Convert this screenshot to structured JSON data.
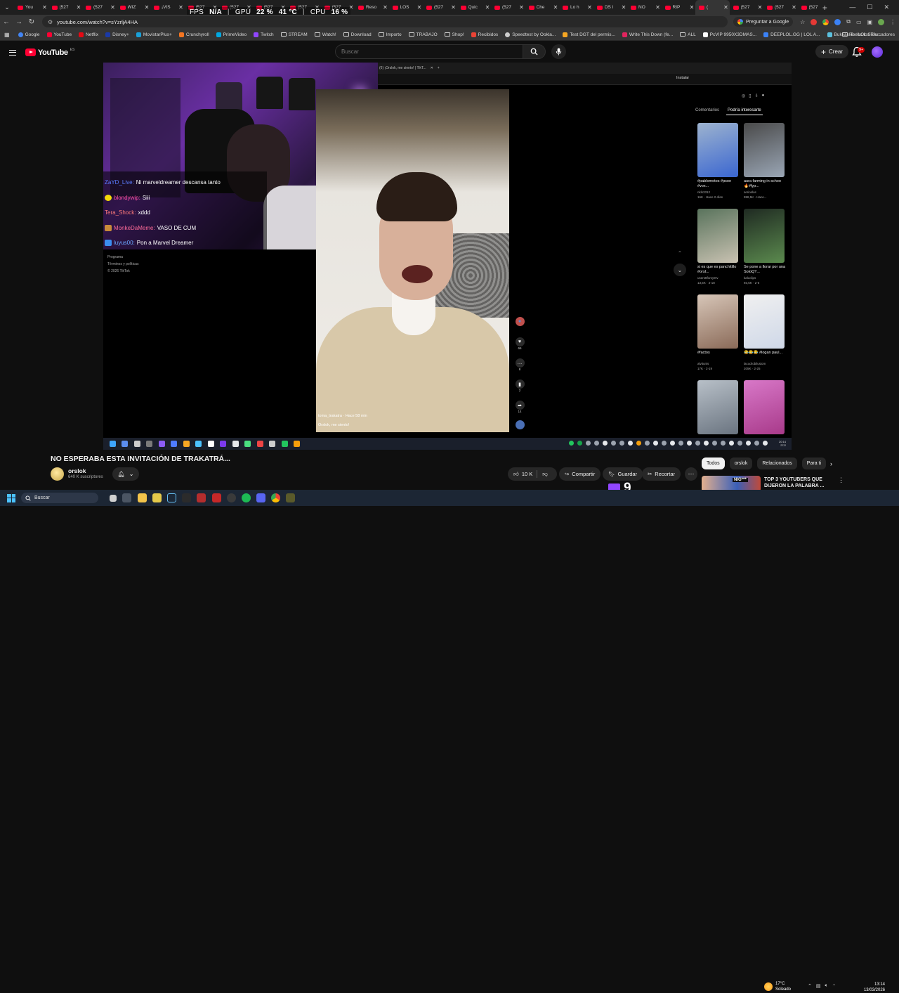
{
  "browser": {
    "tabs": [
      {
        "label": "You",
        "active": false
      },
      {
        "label": "(527",
        "active": false
      },
      {
        "label": "(527",
        "active": false
      },
      {
        "label": "WIZ",
        "active": false
      },
      {
        "label": "¡VIS",
        "active": false
      },
      {
        "label": "(527",
        "active": false
      },
      {
        "label": "(527",
        "active": false
      },
      {
        "label": "(527",
        "active": false
      },
      {
        "label": "(527",
        "active": false
      },
      {
        "label": "(527",
        "active": false
      },
      {
        "label": "Reso",
        "active": false
      },
      {
        "label": "LOS",
        "active": false
      },
      {
        "label": "(527",
        "active": false
      },
      {
        "label": "Quic",
        "active": false
      },
      {
        "label": "(527",
        "active": false
      },
      {
        "label": "Che",
        "active": false
      },
      {
        "label": "Lo h",
        "active": false
      },
      {
        "label": "OS l",
        "active": false
      },
      {
        "label": "NO",
        "active": false
      },
      {
        "label": "RIP",
        "active": false
      },
      {
        "label": "(",
        "active": true
      },
      {
        "label": "(527",
        "active": false
      },
      {
        "label": "(527",
        "active": false
      },
      {
        "label": "(527",
        "active": false
      }
    ],
    "url": "youtube.com/watch?v=sYzrljA4HA",
    "ask_google": "Preguntar a Google",
    "bookmarks": [
      {
        "label": "Google",
        "icon": "google-icon",
        "color": "#4285f4"
      },
      {
        "label": "YouTube",
        "icon": "youtube-icon",
        "color": "#ff0033"
      },
      {
        "label": "Netflix",
        "icon": "netflix-icon",
        "color": "#e50914"
      },
      {
        "label": "Disney+",
        "icon": "disney-icon",
        "color": "#1a3aa8"
      },
      {
        "label": "MovistarPlus+",
        "icon": "movistar-icon",
        "color": "#19a0d8"
      },
      {
        "label": "Crunchyroll",
        "icon": "crunchyroll-icon",
        "color": "#f47521"
      },
      {
        "label": "PrimeVideo",
        "icon": "primevideo-icon",
        "color": "#00a8e1"
      },
      {
        "label": "Twitch",
        "icon": "twitch-icon",
        "color": "#9146ff"
      },
      {
        "label": "STREAM",
        "icon": "folder-icon",
        "color": ""
      },
      {
        "label": "Watch!",
        "icon": "folder-icon",
        "color": ""
      },
      {
        "label": "Download",
        "icon": "folder-icon",
        "color": ""
      },
      {
        "label": "Importo",
        "icon": "folder-icon",
        "color": ""
      },
      {
        "label": "TRABAJO",
        "icon": "folder-icon",
        "color": ""
      },
      {
        "label": "Shop!",
        "icon": "folder-icon",
        "color": ""
      },
      {
        "label": "Recibidos",
        "icon": "gmail-icon",
        "color": "#ea4335"
      },
      {
        "label": "Speedtest by Ookla...",
        "icon": "speedtest-icon",
        "color": "#cccccc"
      },
      {
        "label": "Test DGT del permis...",
        "icon": "dgt-icon",
        "color": "#f5a623"
      },
      {
        "label": "Write This Down (fe...",
        "icon": "music-icon",
        "color": "#e0245e"
      },
      {
        "label": "ALL",
        "icon": "folder-icon",
        "color": ""
      },
      {
        "label": "PcVIP 9950X3DMAS...",
        "icon": "pcvip-icon",
        "color": "#ffffff"
      },
      {
        "label": "DEEPLOL.GG | LOL A...",
        "icon": "deeplol-icon",
        "color": "#3b82f6"
      },
      {
        "label": "Bukkakke - LOL STA...",
        "icon": "lolstats-icon",
        "color": "#5bc0de"
      }
    ],
    "all_bookmarks": "Todos los marcadores"
  },
  "hud": {
    "fps_label": "FPS",
    "fps_value": "N/A",
    "gpu_label": "GPU",
    "gpu_value": "22 %",
    "gpu_temp": "41 °C",
    "cpu_label": "CPU",
    "cpu_value": "16 %"
  },
  "youtube": {
    "logo_text": "YouTube",
    "logo_country": "ES",
    "search_placeholder": "Buscar",
    "create_label": "Crear",
    "notif_count": "9+",
    "video_title": "NO ESPERABA ESTA INVITACIÓN DE TRAKATRÁ...",
    "channel_name": "orslok",
    "channel_subs": "640 K suscriptores",
    "likes": "10 K",
    "share_label": "Compartir",
    "save_label": "Guardar",
    "clip_label": "Recortar",
    "twitch_overlay_number": "9",
    "chips": [
      {
        "label": "Todos",
        "active": true
      },
      {
        "label": "orslok",
        "active": false
      },
      {
        "label": "Relacionados",
        "active": false
      },
      {
        "label": "Para ti",
        "active": false
      }
    ],
    "rec": {
      "thumb_label": "NIG***",
      "title": "TOP 3 YOUTUBERS QUE DIJERON LA PALABRA ..."
    }
  },
  "stream_chat": [
    {
      "user": "ZaYD_Live:",
      "msg": "Ni marveldreamer descansa tanto",
      "color": "#5b7cff",
      "badge": ""
    },
    {
      "user": "blondywip:",
      "msg": "Siii",
      "color": "#ff4fa3",
      "badge": "#f5d90a"
    },
    {
      "user": "Tera_Shock:",
      "msg": "xddd",
      "color": "#ff7a7a",
      "badge": ""
    },
    {
      "user": "MonkeDaMeme:",
      "msg": "VASO DE CUM",
      "color": "#ff6b9a",
      "badge": "#c98b3a"
    },
    {
      "user": "luyus00:",
      "msg": "Pon a Marvel Dreamer",
      "color": "#6aa7ff",
      "badge": "#3b8df0"
    }
  ],
  "tiktok": {
    "footer": [
      "Programa",
      "Términos y políticas",
      "© 2026 TikTok"
    ],
    "screen_tab": "(6) ¡Orslok, me siento! | TikT...",
    "install_label": "Instalar",
    "user": "toma_trakatra · Hace 58 min",
    "caption": "Orslok, me siento!",
    "actions": [
      {
        "icon": "avatar-icon",
        "count": ""
      },
      {
        "icon": "heart-icon",
        "count": "66"
      },
      {
        "icon": "comment-icon",
        "count": "8"
      },
      {
        "icon": "bookmark-icon",
        "count": "2"
      },
      {
        "icon": "share-icon",
        "count": "14"
      }
    ],
    "side_tabs": [
      {
        "label": "Comentarios",
        "active": false
      },
      {
        "label": "Podría interesarte",
        "active": true
      }
    ],
    "suggestions": [
      {
        "title": "#pablomotos #psoe #vox...",
        "meta1": "nkls3312",
        "meta2": "16K · Hace 2 días",
        "color1": "#9db3cf",
        "color2": "#3a66d0"
      },
      {
        "title": "aura farming in schoo 🔥#fyp...",
        "meta1": "serioslos",
        "meta2": "998,5K · Hace...",
        "color1": "#4a4a4a",
        "color2": "#9aa6b5"
      },
      {
        "title": "si es que es panchitillo #orsl...",
        "meta1": "usersttf1my9rv",
        "meta2": "13,5K · 2-18",
        "color1": "#59735c",
        "color2": "#c9c2b2"
      },
      {
        "title": "Se pone a llorar por una SoloQ?...",
        "meta1": "kaluclips",
        "meta2": "93,5K · 2-6",
        "color1": "#1f2a22",
        "color2": "#5b8a4e"
      },
      {
        "title": "#factos",
        "meta1": "alvitunis",
        "meta2": "17K · 2-19",
        "color1": "#d7c6b8",
        "color2": "#8a6a58"
      },
      {
        "title": "😂😂😂 #logan paul...",
        "meta1": "lacodrobilusiom",
        "meta2": "205K · 2-25",
        "color1": "#f0f0f0",
        "color2": "#cfd8e8"
      },
      {
        "title": "",
        "meta1": "",
        "meta2": "",
        "color1": "#b8c0c8",
        "color2": "#6a7480"
      },
      {
        "title": "",
        "meta1": "",
        "meta2": "",
        "color1": "#d878c8",
        "color2": "#a83a8a"
      }
    ],
    "inner_clock_time": "20:14",
    "inner_clock_date": "27/2"
  },
  "windows": {
    "search_placeholder": "Buscar",
    "weather_temp": "17°C",
    "weather_desc": "Soleado",
    "time": "13:14",
    "date": "13/03/2026"
  }
}
